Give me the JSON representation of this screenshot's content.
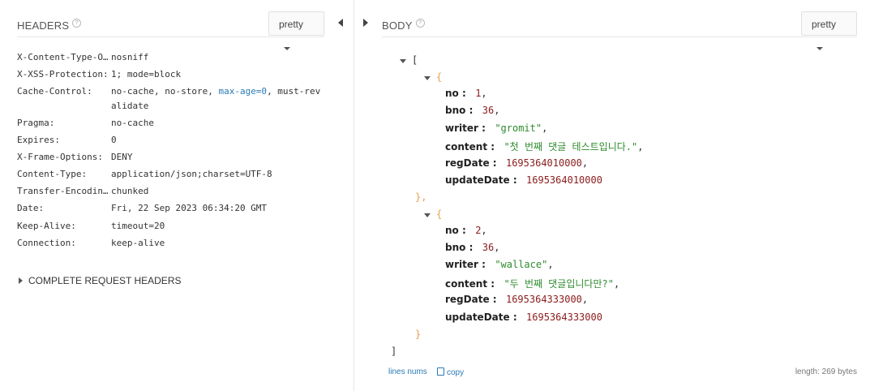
{
  "headers_panel": {
    "title": "HEADERS",
    "help": "?",
    "format": "pretty",
    "rows": [
      {
        "name": "X-Content-Type-O…",
        "value": "nosniff"
      },
      {
        "name": "X-XSS-Protection:",
        "value": "1; mode=block"
      },
      {
        "name": "Cache-Control:",
        "value_pre": "no-cache, no-store, ",
        "value_kw": "max-age=0",
        "value_post": ", must-rev",
        "value_cont": "alidate"
      },
      {
        "name": "Pragma:",
        "value": "no-cache"
      },
      {
        "name": "Expires:",
        "value": "0"
      },
      {
        "name": "X-Frame-Options:",
        "value": "DENY"
      },
      {
        "name": "Content-Type:",
        "value": "application/json;charset=UTF-8"
      },
      {
        "name": "Transfer-Encodin…",
        "value": "chunked"
      },
      {
        "name": "Date:",
        "value": "Fri, 22 Sep 2023 06:34:20 GMT"
      },
      {
        "name": "Keep-Alive:",
        "value": "timeout=20"
      },
      {
        "name": "Connection:",
        "value": "keep-alive"
      }
    ],
    "complete_label": "COMPLETE REQUEST HEADERS"
  },
  "body_panel": {
    "title": "BODY",
    "help": "?",
    "format": "pretty",
    "json": {
      "open_array": "[",
      "close_array": "]",
      "open_obj": "{",
      "close_obj": "}",
      "close_obj_comma": "},",
      "items": [
        {
          "no_key": "no",
          "no": "1",
          "bno_key": "bno",
          "bno": "36",
          "writer_key": "writer",
          "writer": "\"gromit\"",
          "content_key": "content",
          "content": "\"첫 번째 댓글 테스트입니다.\"",
          "regDate_key": "regDate",
          "regDate": "1695364010000",
          "updateDate_key": "updateDate",
          "updateDate": "1695364010000"
        },
        {
          "no_key": "no",
          "no": "2",
          "bno_key": "bno",
          "bno": "36",
          "writer_key": "writer",
          "writer": "\"wallace\"",
          "content_key": "content",
          "content": "\"두 번째 댓글입니다만?\"",
          "regDate_key": "regDate",
          "regDate": "1695364333000",
          "updateDate_key": "updateDate",
          "updateDate": "1695364333000"
        }
      ]
    },
    "footer": {
      "line_nums": "lines nums",
      "copy": "copy",
      "length": "length: 269 bytes"
    }
  }
}
